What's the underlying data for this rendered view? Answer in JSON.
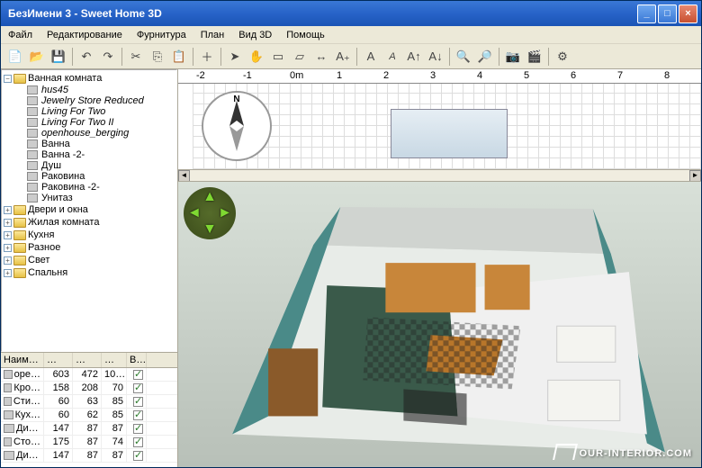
{
  "window": {
    "title": "БезИмени 3 - Sweet Home 3D"
  },
  "menu": {
    "file": "Файл",
    "edit": "Редактирование",
    "furniture": "Фурнитура",
    "plan": "План",
    "view3d": "Вид 3D",
    "help": "Помощь"
  },
  "catalog": {
    "root": "Ванная комната",
    "items": [
      {
        "label": "hus45",
        "italic": true
      },
      {
        "label": "Jewelry Store Reduced",
        "italic": true
      },
      {
        "label": "Living For Two",
        "italic": true
      },
      {
        "label": "Living For Two II",
        "italic": true
      },
      {
        "label": "openhouse_berging",
        "italic": true
      },
      {
        "label": "Ванна",
        "italic": false
      },
      {
        "label": "Ванна -2-",
        "italic": false
      },
      {
        "label": "Душ",
        "italic": false
      },
      {
        "label": "Раковина",
        "italic": false
      },
      {
        "label": "Раковина -2-",
        "italic": false
      },
      {
        "label": "Унитаз",
        "italic": false
      }
    ],
    "categories": [
      {
        "label": "Двери и окна"
      },
      {
        "label": "Жилая комната"
      },
      {
        "label": "Кухня"
      },
      {
        "label": "Разное"
      },
      {
        "label": "Свет"
      },
      {
        "label": "Спальня"
      }
    ]
  },
  "table": {
    "headers": {
      "name": "Наим…",
      "w": "…",
      "d": "…",
      "h": "…",
      "v": "В…"
    },
    "rows": [
      {
        "name": "оре…",
        "w": "603",
        "d": "472",
        "h": "10…",
        "v": true
      },
      {
        "name": "Кро…",
        "w": "158",
        "d": "208",
        "h": "70",
        "v": true
      },
      {
        "name": "Сти…",
        "w": "60",
        "d": "63",
        "h": "85",
        "v": true
      },
      {
        "name": "Кух…",
        "w": "60",
        "d": "62",
        "h": "85",
        "v": true
      },
      {
        "name": "Ди…",
        "w": "147",
        "d": "87",
        "h": "87",
        "v": true
      },
      {
        "name": "Сто…",
        "w": "175",
        "d": "87",
        "h": "74",
        "v": true
      },
      {
        "name": "Ди…",
        "w": "147",
        "d": "87",
        "h": "87",
        "v": true
      }
    ]
  },
  "ruler": {
    "ticks": [
      "-2",
      "-1",
      "0m",
      "1",
      "2",
      "3",
      "4",
      "5",
      "6",
      "7",
      "8"
    ]
  },
  "watermark": "OUR-INTERIOR.COM",
  "colors": {
    "titlebar": "#2763c8",
    "bg": "#ece9d8"
  }
}
